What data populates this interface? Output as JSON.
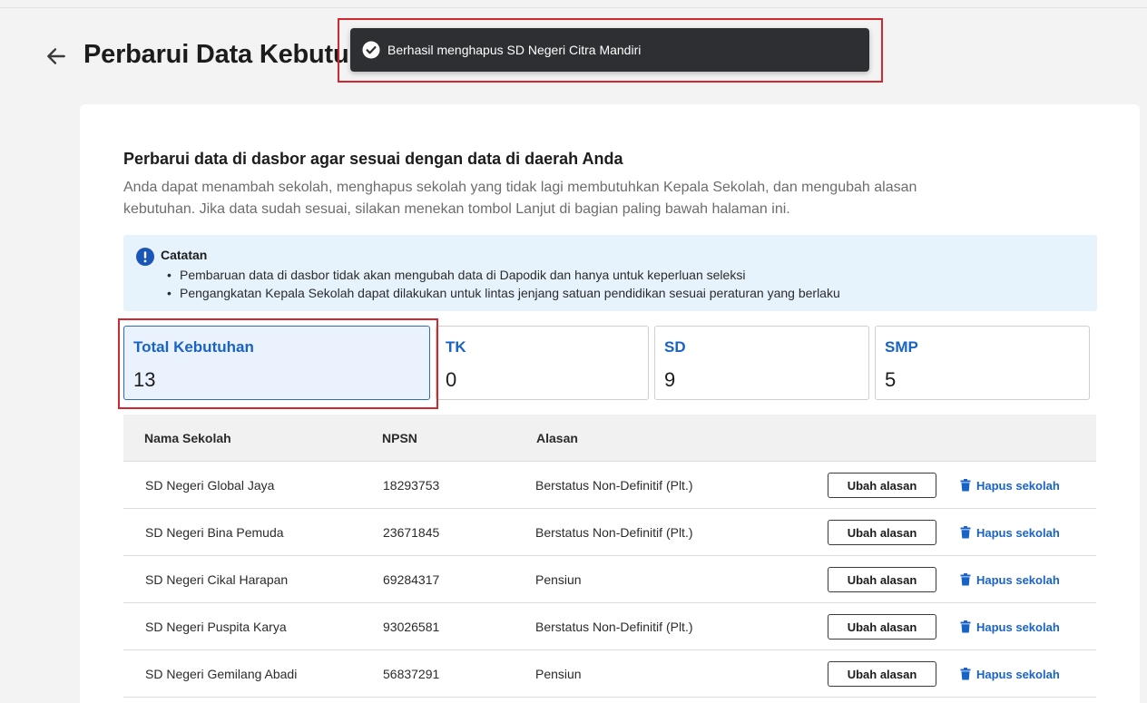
{
  "header": {
    "title": "Perbarui Data Kebutuhan"
  },
  "toast": {
    "message": "Berhasil menghapus SD Negeri Citra Mandiri",
    "icon": "check-circle-icon"
  },
  "section": {
    "title": "Perbarui data di dasbor agar sesuai dengan data di daerah Anda",
    "description": "Anda dapat menambah sekolah, menghapus sekolah yang tidak lagi membutuhkan Kepala Sekolah, dan mengubah alasan kebutuhan. Jika data sudah sesuai, silakan menekan tombol Lanjut di bagian paling bawah halaman ini."
  },
  "note": {
    "title": "Catatan",
    "items": [
      "Pembaruan data di dasbor tidak akan mengubah data di Dapodik dan hanya untuk keperluan seleksi",
      "Pengangkatan Kepala Sekolah dapat dilakukan untuk lintas jenjang satuan pendidikan sesuai peraturan yang berlaku"
    ]
  },
  "stats": [
    {
      "label": "Total Kebutuhan",
      "value": "13"
    },
    {
      "label": "TK",
      "value": "0"
    },
    {
      "label": "SD",
      "value": "9"
    },
    {
      "label": "SMP",
      "value": "5"
    }
  ],
  "table": {
    "headers": {
      "name": "Nama Sekolah",
      "npsn": "NPSN",
      "alasan": "Alasan"
    },
    "edit_label": "Ubah alasan",
    "delete_label": "Hapus sekolah",
    "rows": [
      {
        "name": "SD Negeri Global Jaya",
        "npsn": "18293753",
        "alasan": "Berstatus Non-Definitif (Plt.)"
      },
      {
        "name": "SD Negeri Bina Pemuda",
        "npsn": "23671845",
        "alasan": "Berstatus Non-Definitif (Plt.)"
      },
      {
        "name": "SD Negeri Cikal Harapan",
        "npsn": "69284317",
        "alasan": "Pensiun"
      },
      {
        "name": "SD Negeri Puspita Karya",
        "npsn": "93026581",
        "alasan": "Berstatus Non-Definitif (Plt.)"
      },
      {
        "name": "SD Negeri Gemilang Abadi",
        "npsn": "56837291",
        "alasan": "Pensiun"
      }
    ]
  },
  "colors": {
    "accent": "#1a63c6",
    "highlight": "#d0282e",
    "toast_bg": "#2d2f33",
    "note_bg": "#e6f3fd"
  }
}
